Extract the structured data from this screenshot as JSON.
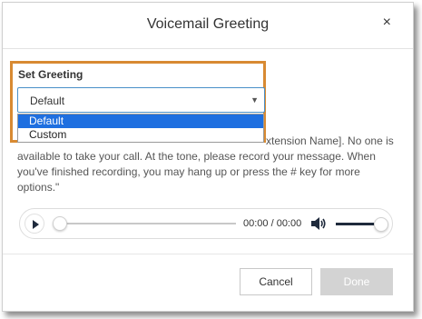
{
  "dialog": {
    "title": "Voicemail Greeting",
    "close_glyph": "×"
  },
  "greeting": {
    "label": "Set Greeting",
    "selected_value": "Default",
    "options": [
      {
        "label": "Default",
        "selected": true
      },
      {
        "label": "Custom",
        "selected": false
      }
    ]
  },
  "message": {
    "lines": [
      "xtension Name]. No one is",
      "available to take your call. At the tone, please record your message. When",
      "you've finished recording, you may hang up or press the # key for more",
      "options.\""
    ]
  },
  "player": {
    "time": "00:00 / 00:00",
    "play_icon": "play-icon",
    "volume_icon": "volume-icon"
  },
  "footer": {
    "cancel_label": "Cancel",
    "done_label": "Done"
  },
  "colors": {
    "highlight_border": "#d88a32",
    "selected_option_bg": "#1e6fe0",
    "done_disabled_bg": "#d3d3d3"
  }
}
